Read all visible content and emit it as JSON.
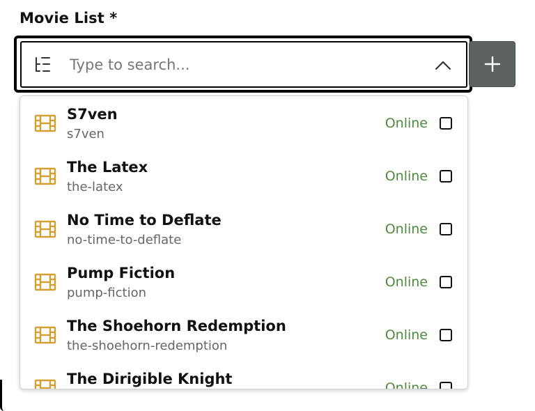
{
  "field": {
    "label": "Movie List *",
    "search_placeholder": "Type to search...",
    "search_value": ""
  },
  "colors": {
    "accent_icon": "#d4a032",
    "status_online": "#4e8a3e",
    "add_button_bg": "#5c6161"
  },
  "icons": {
    "tree": "tree-list-icon",
    "chevron": "chevron-up-icon",
    "add": "plus-icon",
    "item": "film-icon"
  },
  "options": [
    {
      "title": "S7ven",
      "slug": "s7ven",
      "status": "Online",
      "checked": false
    },
    {
      "title": "The Latex",
      "slug": "the-latex",
      "status": "Online",
      "checked": false
    },
    {
      "title": "No Time to Deflate",
      "slug": "no-time-to-deflate",
      "status": "Online",
      "checked": false
    },
    {
      "title": "Pump Fiction",
      "slug": "pump-fiction",
      "status": "Online",
      "checked": false
    },
    {
      "title": "The Shoehorn Redemption",
      "slug": "the-shoehorn-redemption",
      "status": "Online",
      "checked": false
    },
    {
      "title": "The Dirigible Knight",
      "slug": "",
      "status": "Online",
      "checked": false
    }
  ]
}
